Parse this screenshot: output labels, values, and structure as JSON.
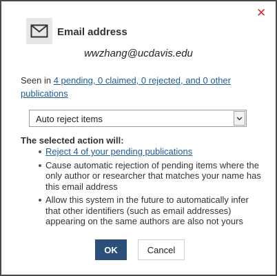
{
  "dialog": {
    "close_icon": "close-icon",
    "title_icon": "envelope-icon",
    "title": "Email address",
    "email": "wwzhang@ucdavis.edu",
    "seen_prefix": "Seen in ",
    "seen_link": "4 pending, 0 claimed, 0 rejected, and 0 other publications",
    "select": {
      "value": "Auto reject items",
      "arrow_icon": "chevron-down-icon"
    },
    "action_heading": "The selected action will:",
    "actions": [
      "Reject 4 of your pending publications",
      "Cause automatic rejection of pending items where the only author or researcher that matches your name has this email address",
      "Allow this system in the future to automatically infer that other identifiers (such as email addresses) appearing on the same authors are also not yours"
    ],
    "ok_label": "OK",
    "cancel_label": "Cancel"
  },
  "colors": {
    "primary_button": "#2c4f79",
    "link": "#1f5a96",
    "close": "#e02b2b",
    "backdrop": "#4a4a4a"
  }
}
